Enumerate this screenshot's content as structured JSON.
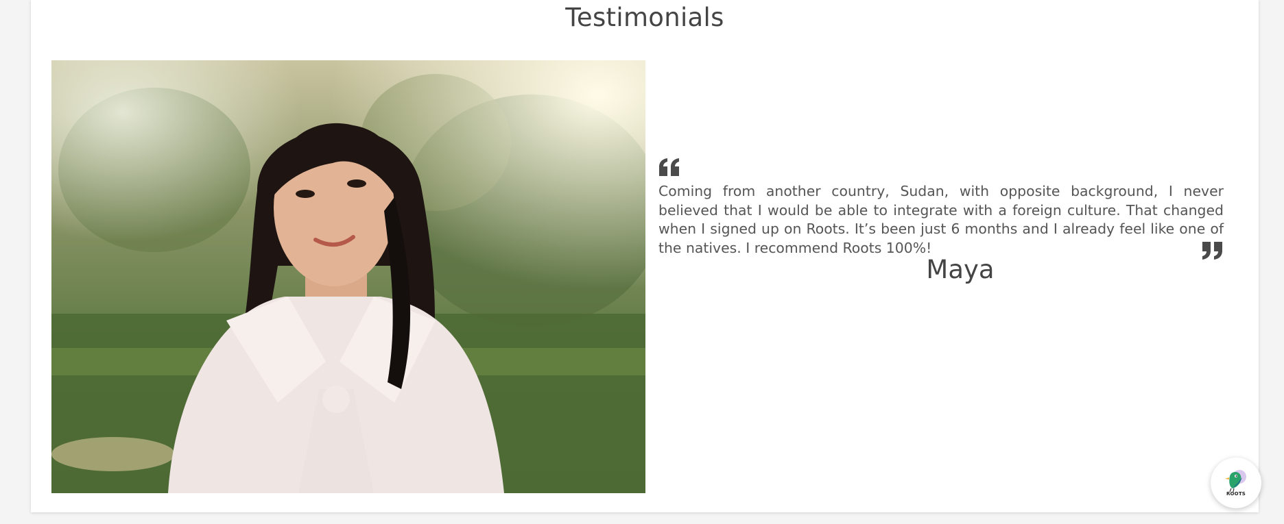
{
  "section": {
    "title": "Testimonials"
  },
  "testimonial": {
    "quote": "Coming from another country, Sudan, with opposite background, I never believed that I would be able to integrate with a foreign culture. That changed when I signed up on Roots. It’s been just 6 months and I already feel like one of the natives. I recommend Roots 100%!",
    "author": "Maya",
    "photo_icon": "testimonial-photo",
    "open_quote_icon": "quote-open-icon",
    "close_quote_icon": "quote-close-icon"
  },
  "chat_widget": {
    "logo_text": "ROOTS",
    "icon": "roots-bird-logo-icon"
  },
  "colors": {
    "text": "#4a4a4a",
    "card": "#ffffff",
    "background": "#f4f4f4"
  }
}
